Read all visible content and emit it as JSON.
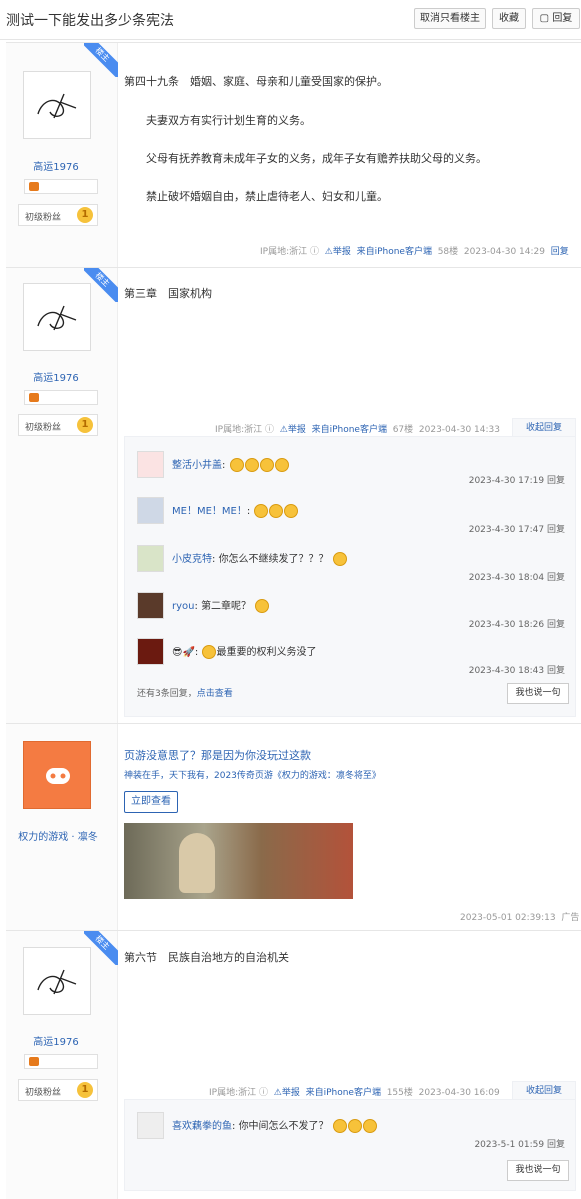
{
  "header": {
    "title": "测试一下能发出多少条宪法",
    "btn_only_op": "取消只看楼主",
    "btn_collect": "收藏",
    "btn_reply": "回复"
  },
  "badge_label": "楼主",
  "rank_label": "初级粉丝",
  "medal": "1",
  "post1": {
    "user": "高运1976",
    "lines": [
      "第四十九条　婚姻、家庭、母亲和儿童受国家的保护。",
      "夫妻双方有实行计划生育的义务。",
      "父母有抚养教育未成年子女的义务，成年子女有赡养扶助父母的义务。",
      "禁止破坏婚姻自由，禁止虐待老人、妇女和儿童。"
    ],
    "ip": "IP属地:浙江",
    "report": "举报",
    "client": "来自iPhone客户端",
    "floor": "58楼",
    "time": "2023-04-30 14:29",
    "reply": "回复"
  },
  "post2": {
    "user": "高运1976",
    "text": "第三章　国家机构",
    "ip": "IP属地:浙江",
    "report": "举报",
    "client": "来自iPhone客户端",
    "floor": "67楼",
    "time": "2023-04-30 14:33",
    "collapse": "收起回复",
    "replies": [
      {
        "name": "整活小井盖",
        "text": "",
        "time": "2023-4-30 17:19",
        "reply": "回复"
      },
      {
        "name": "ME！ME！ME！",
        "text": "",
        "time": "2023-4-30 17:47",
        "reply": "回复"
      },
      {
        "name": "小皮克特",
        "text": "你怎么不继续发了？？？",
        "time": "2023-4-30 18:04",
        "reply": "回复"
      },
      {
        "name": "ryou",
        "text": "第二章呢？",
        "time": "2023-4-30 18:26",
        "reply": "回复"
      },
      {
        "name": "",
        "text": "最重要的权利义务没了",
        "time": "2023-4-30 18:43",
        "reply": "回复"
      }
    ],
    "more_prefix": "还有3条回复，",
    "more_link": "点击查看",
    "say": "我也说一句"
  },
  "ad": {
    "name": "权力的游戏 · 凛冬",
    "title": "页游没意思了？那是因为你没玩过这款",
    "desc": "神装在手，天下我有，2023传奇页游《权力的游戏：凛冬将至》",
    "button": "立即查看",
    "time": "2023-05-01 02:39:13",
    "ad_label": "广告"
  },
  "post3": {
    "user": "高运1976",
    "text": "第六节　民族自治地方的自治机关",
    "ip": "IP属地:浙江",
    "report": "举报",
    "client": "来自iPhone客户端",
    "floor": "155楼",
    "time": "2023-04-30 16:09",
    "collapse": "收起回复",
    "replies": [
      {
        "name": "喜欢藕拳的鱼",
        "text": "你中间怎么不发了？",
        "time": "2023-5-1 01:59",
        "reply": "回复"
      }
    ],
    "say": "我也说一句"
  },
  "colors": {
    "link": "#2d64b3",
    "badge": "#4a8cf0",
    "ad_orange": "#f47b42"
  }
}
